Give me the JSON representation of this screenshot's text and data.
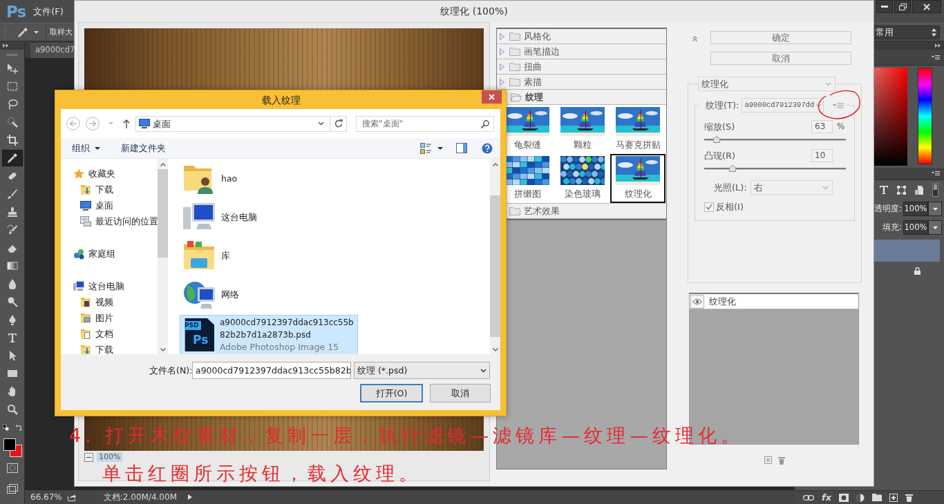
{
  "app": {
    "logo": "Ps",
    "menu": [
      {
        "label": "文件(F)"
      }
    ],
    "options_bar": {
      "sample_label": "取样大",
      "workspace": "常用"
    },
    "document_tab": "a9000cd7",
    "tools": [
      {
        "selected": false
      },
      {
        "selected": false
      },
      {
        "selected": false
      },
      {
        "selected": false
      },
      {
        "selected": false
      },
      {
        "selected": true
      },
      {
        "selected": false
      },
      {
        "selected": false
      },
      {
        "selected": false
      },
      {
        "selected": false
      },
      {
        "selected": false
      },
      {
        "selected": false
      },
      {
        "selected": false
      },
      {
        "selected": false
      },
      {
        "selected": false
      },
      {
        "selected": false
      },
      {
        "selected": false
      },
      {
        "selected": false
      },
      {
        "selected": false
      },
      {
        "selected": false
      }
    ],
    "color_swatches": [
      {
        "color": "#000000"
      },
      {
        "color": "#e8141b"
      }
    ],
    "status_bar": {
      "zoom": "66.67%",
      "doc_size": "文档:2.00M/4.00M"
    },
    "layers_panel": {
      "opacity_label": "透明度:",
      "opacity": "100%",
      "fill_label": "填充:",
      "fill": "100%",
      "effects_label": "fx"
    }
  },
  "filter_gallery": {
    "title": "纹理化 (100%)",
    "preview_zoom": "100%",
    "categories": [
      {
        "name": "风格化",
        "expanded": false
      },
      {
        "name": "画笔描边",
        "expanded": false
      },
      {
        "name": "扭曲",
        "expanded": false
      },
      {
        "name": "素描",
        "expanded": false
      },
      {
        "name": "纹理",
        "expanded": true,
        "filters": [
          {
            "name": "龟裂缝",
            "selected": false
          },
          {
            "name": "颗粒",
            "selected": false
          },
          {
            "name": "马赛克拼贴",
            "selected": false
          },
          {
            "name": "拼缀图",
            "selected": false
          },
          {
            "name": "染色玻璃",
            "selected": false
          },
          {
            "name": "纹理化",
            "selected": true
          }
        ]
      },
      {
        "name": "艺术效果",
        "expanded": false
      }
    ],
    "buttons": [
      {
        "label": "确定"
      },
      {
        "label": "取消"
      }
    ],
    "filter_select": "纹理化",
    "texture": {
      "label": "纹理(T):",
      "value": "a9000cd7912397dd"
    },
    "scaling": {
      "label": "缩放(S)",
      "value": "63",
      "unit": "%",
      "level": 0.09
    },
    "relief": {
      "label": "凸现(R)",
      "value": "10",
      "level": 0.2
    },
    "light": {
      "label": "光照(L):",
      "value": "右"
    },
    "invert": {
      "label": "反相(I)",
      "checked": true
    },
    "effect_layers": [
      {
        "name": "纹理化",
        "visible": true
      }
    ]
  },
  "load_dialog": {
    "title": "载入纹理",
    "address": "桌面",
    "search": {
      "placeholder": "搜索\"桌面\""
    },
    "toolbar": [
      {
        "label": "组织",
        "dropdown": true
      },
      {
        "label": "新建文件夹",
        "dropdown": false
      }
    ],
    "nav": [
      {
        "label": "收藏夹",
        "children": [
          {
            "label": "下载"
          },
          {
            "label": "桌面"
          },
          {
            "label": "最近访问的位置"
          }
        ]
      },
      {
        "label": "家庭组"
      },
      {
        "label": "这台电脑",
        "children": [
          {
            "label": "视频"
          },
          {
            "label": "图片"
          },
          {
            "label": "文档"
          },
          {
            "label": "下载"
          }
        ]
      }
    ],
    "files": [
      {
        "name": "hao",
        "selected": false
      },
      {
        "name": "这台电脑",
        "selected": false
      },
      {
        "name": "库",
        "selected": false
      },
      {
        "name": "网络",
        "selected": false
      },
      {
        "name": "a9000cd7912397ddac913cc55b82b2b7d1a2873b.psd",
        "type": "Adobe Photoshop Image 15",
        "badge": "PSD",
        "logo": "Ps",
        "selected": true
      }
    ],
    "file_name": {
      "label": "文件名(N):",
      "value": "a9000cd7912397ddac913cc55b82b"
    },
    "file_type": "纹理 (*.psd)",
    "buttons": [
      {
        "label": "打开(O)",
        "default": true
      },
      {
        "label": "取消",
        "default": false
      }
    ]
  },
  "annotation": {
    "lines": [
      "4. 打开木纹素材，复制一层，执行滤镜—滤镜库—纹理—纹理化。",
      "单击红圈所示按钮，载入纹理。"
    ]
  }
}
